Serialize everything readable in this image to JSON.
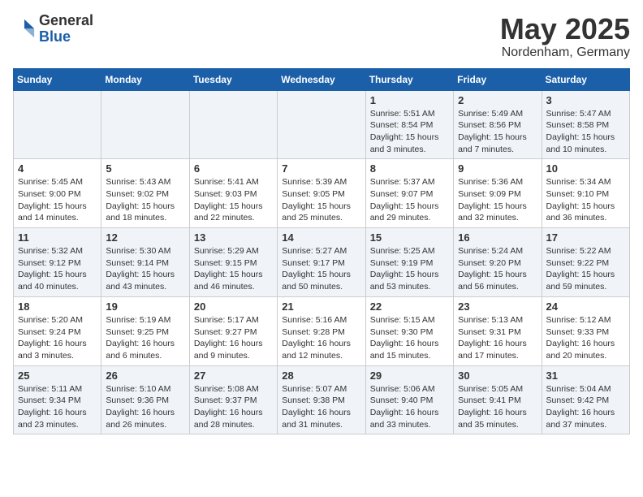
{
  "header": {
    "logo_general": "General",
    "logo_blue": "Blue",
    "month_title": "May 2025",
    "location": "Nordenham, Germany"
  },
  "days_of_week": [
    "Sunday",
    "Monday",
    "Tuesday",
    "Wednesday",
    "Thursday",
    "Friday",
    "Saturday"
  ],
  "weeks": [
    [
      {
        "day": "",
        "info": ""
      },
      {
        "day": "",
        "info": ""
      },
      {
        "day": "",
        "info": ""
      },
      {
        "day": "",
        "info": ""
      },
      {
        "day": "1",
        "info": "Sunrise: 5:51 AM\nSunset: 8:54 PM\nDaylight: 15 hours\nand 3 minutes."
      },
      {
        "day": "2",
        "info": "Sunrise: 5:49 AM\nSunset: 8:56 PM\nDaylight: 15 hours\nand 7 minutes."
      },
      {
        "day": "3",
        "info": "Sunrise: 5:47 AM\nSunset: 8:58 PM\nDaylight: 15 hours\nand 10 minutes."
      }
    ],
    [
      {
        "day": "4",
        "info": "Sunrise: 5:45 AM\nSunset: 9:00 PM\nDaylight: 15 hours\nand 14 minutes."
      },
      {
        "day": "5",
        "info": "Sunrise: 5:43 AM\nSunset: 9:02 PM\nDaylight: 15 hours\nand 18 minutes."
      },
      {
        "day": "6",
        "info": "Sunrise: 5:41 AM\nSunset: 9:03 PM\nDaylight: 15 hours\nand 22 minutes."
      },
      {
        "day": "7",
        "info": "Sunrise: 5:39 AM\nSunset: 9:05 PM\nDaylight: 15 hours\nand 25 minutes."
      },
      {
        "day": "8",
        "info": "Sunrise: 5:37 AM\nSunset: 9:07 PM\nDaylight: 15 hours\nand 29 minutes."
      },
      {
        "day": "9",
        "info": "Sunrise: 5:36 AM\nSunset: 9:09 PM\nDaylight: 15 hours\nand 32 minutes."
      },
      {
        "day": "10",
        "info": "Sunrise: 5:34 AM\nSunset: 9:10 PM\nDaylight: 15 hours\nand 36 minutes."
      }
    ],
    [
      {
        "day": "11",
        "info": "Sunrise: 5:32 AM\nSunset: 9:12 PM\nDaylight: 15 hours\nand 40 minutes."
      },
      {
        "day": "12",
        "info": "Sunrise: 5:30 AM\nSunset: 9:14 PM\nDaylight: 15 hours\nand 43 minutes."
      },
      {
        "day": "13",
        "info": "Sunrise: 5:29 AM\nSunset: 9:15 PM\nDaylight: 15 hours\nand 46 minutes."
      },
      {
        "day": "14",
        "info": "Sunrise: 5:27 AM\nSunset: 9:17 PM\nDaylight: 15 hours\nand 50 minutes."
      },
      {
        "day": "15",
        "info": "Sunrise: 5:25 AM\nSunset: 9:19 PM\nDaylight: 15 hours\nand 53 minutes."
      },
      {
        "day": "16",
        "info": "Sunrise: 5:24 AM\nSunset: 9:20 PM\nDaylight: 15 hours\nand 56 minutes."
      },
      {
        "day": "17",
        "info": "Sunrise: 5:22 AM\nSunset: 9:22 PM\nDaylight: 15 hours\nand 59 minutes."
      }
    ],
    [
      {
        "day": "18",
        "info": "Sunrise: 5:20 AM\nSunset: 9:24 PM\nDaylight: 16 hours\nand 3 minutes."
      },
      {
        "day": "19",
        "info": "Sunrise: 5:19 AM\nSunset: 9:25 PM\nDaylight: 16 hours\nand 6 minutes."
      },
      {
        "day": "20",
        "info": "Sunrise: 5:17 AM\nSunset: 9:27 PM\nDaylight: 16 hours\nand 9 minutes."
      },
      {
        "day": "21",
        "info": "Sunrise: 5:16 AM\nSunset: 9:28 PM\nDaylight: 16 hours\nand 12 minutes."
      },
      {
        "day": "22",
        "info": "Sunrise: 5:15 AM\nSunset: 9:30 PM\nDaylight: 16 hours\nand 15 minutes."
      },
      {
        "day": "23",
        "info": "Sunrise: 5:13 AM\nSunset: 9:31 PM\nDaylight: 16 hours\nand 17 minutes."
      },
      {
        "day": "24",
        "info": "Sunrise: 5:12 AM\nSunset: 9:33 PM\nDaylight: 16 hours\nand 20 minutes."
      }
    ],
    [
      {
        "day": "25",
        "info": "Sunrise: 5:11 AM\nSunset: 9:34 PM\nDaylight: 16 hours\nand 23 minutes."
      },
      {
        "day": "26",
        "info": "Sunrise: 5:10 AM\nSunset: 9:36 PM\nDaylight: 16 hours\nand 26 minutes."
      },
      {
        "day": "27",
        "info": "Sunrise: 5:08 AM\nSunset: 9:37 PM\nDaylight: 16 hours\nand 28 minutes."
      },
      {
        "day": "28",
        "info": "Sunrise: 5:07 AM\nSunset: 9:38 PM\nDaylight: 16 hours\nand 31 minutes."
      },
      {
        "day": "29",
        "info": "Sunrise: 5:06 AM\nSunset: 9:40 PM\nDaylight: 16 hours\nand 33 minutes."
      },
      {
        "day": "30",
        "info": "Sunrise: 5:05 AM\nSunset: 9:41 PM\nDaylight: 16 hours\nand 35 minutes."
      },
      {
        "day": "31",
        "info": "Sunrise: 5:04 AM\nSunset: 9:42 PM\nDaylight: 16 hours\nand 37 minutes."
      }
    ]
  ]
}
